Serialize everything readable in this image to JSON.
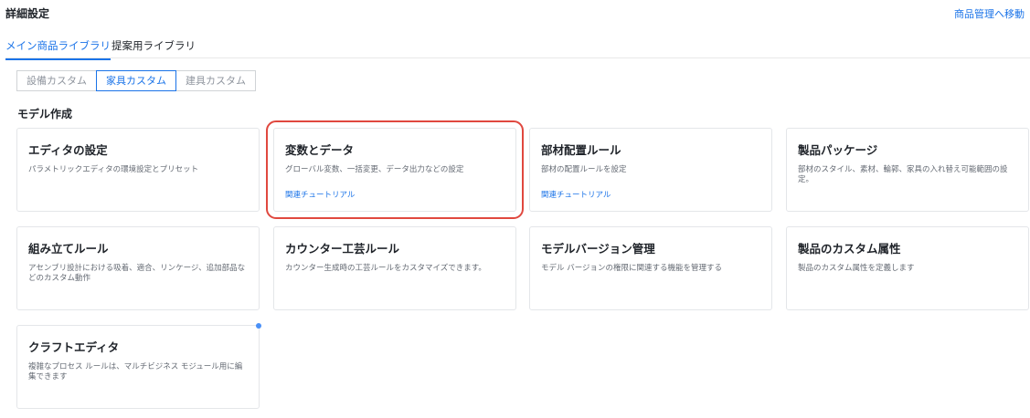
{
  "header": {
    "title": "詳細設定",
    "link": "商品管理へ移動"
  },
  "tabs": [
    {
      "label": "メイン商品ライブラリ",
      "active": true
    },
    {
      "label": "提案用ライブラリ",
      "active": false
    }
  ],
  "segments": [
    {
      "label": "設備カスタム",
      "active": false
    },
    {
      "label": "家具カスタム",
      "active": true
    },
    {
      "label": "建具カスタム",
      "active": false
    }
  ],
  "section": {
    "title": "モデル作成"
  },
  "cards": [
    {
      "title": "エディタの設定",
      "desc": "パラメトリックエディタの環境設定とプリセット",
      "link": ""
    },
    {
      "title": "変数とデータ",
      "desc": "グローバル変数、一括変更、データ出力などの設定",
      "link": "関連チュートリアル",
      "highlighted": true
    },
    {
      "title": "部材配置ルール",
      "desc": "部材の配置ルールを設定",
      "link": "関連チュートリアル"
    },
    {
      "title": "製品パッケージ",
      "desc": "部材のスタイル、素材、輪郭、家具の入れ替え可能範囲の設定。",
      "link": ""
    },
    {
      "title": "組み立てルール",
      "desc": "アセンブリ設計における吸着、適合、リンケージ、追加部品などのカスタム動作",
      "link": ""
    },
    {
      "title": "カウンター工芸ルール",
      "desc": "カウンター生成時の工芸ルールをカスタマイズできます。",
      "link": ""
    },
    {
      "title": "モデルバージョン管理",
      "desc": "モデル バージョンの権限に関連する機能を管理する",
      "link": ""
    },
    {
      "title": "製品のカスタム属性",
      "desc": "製品のカスタム属性を定義します",
      "link": ""
    },
    {
      "title": "クラフトエディタ",
      "desc": "複雑なプロセス ルールは、マルチビジネス モジュール用に編集できます",
      "link": "",
      "new_dot": true
    }
  ],
  "colors": {
    "accent": "#1a73e8",
    "highlight": "#e0483f",
    "dot": "#4a90f7"
  }
}
